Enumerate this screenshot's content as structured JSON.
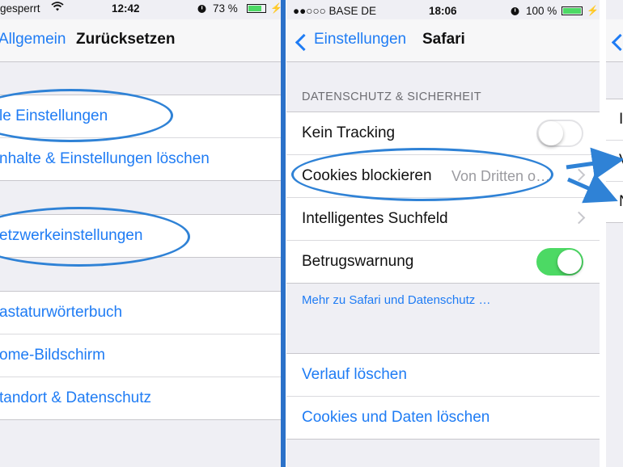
{
  "left": {
    "status": {
      "carrier": "gesperrt",
      "time": "12:42",
      "battery": "73 %"
    },
    "nav": {
      "back": "Allgemein",
      "title": "Zurücksetzen"
    },
    "group1": [
      "le Einstellungen",
      "nhalte & Einstellungen löschen"
    ],
    "group2": [
      "etzwerkeinstellungen"
    ],
    "group3": [
      "astaturwörterbuch",
      "ome-Bildschirm",
      "tandort & Datenschutz"
    ]
  },
  "middle": {
    "status": {
      "carrier": "●●○○○ BASE DE",
      "time": "18:06",
      "battery": "100 %"
    },
    "nav": {
      "back": "Einstellungen",
      "title": "Safari"
    },
    "section_header": "DATENSCHUTZ & SICHERHEIT",
    "privacy_rows": [
      {
        "label": "Kein Tracking",
        "accessory": "toggle",
        "toggle_on": false
      },
      {
        "label": "Cookies blockieren",
        "detail": "Von Dritten o…",
        "accessory": "chevron"
      },
      {
        "label": "Intelligentes Suchfeld",
        "accessory": "chevron"
      },
      {
        "label": "Betrugswarnung",
        "accessory": "toggle",
        "toggle_on": true
      }
    ],
    "footer_link": "Mehr zu Safari und Datenschutz …",
    "clear_rows": [
      "Verlauf löschen",
      "Cookies und Daten löschen"
    ]
  },
  "right": {
    "row_letters": [
      "I",
      "V",
      "N"
    ]
  },
  "colors": {
    "ios_blue": "#1f7cf4",
    "annotation_blue": "#2f82d6",
    "toggle_green": "#4cd964",
    "background": "#efeff4"
  }
}
